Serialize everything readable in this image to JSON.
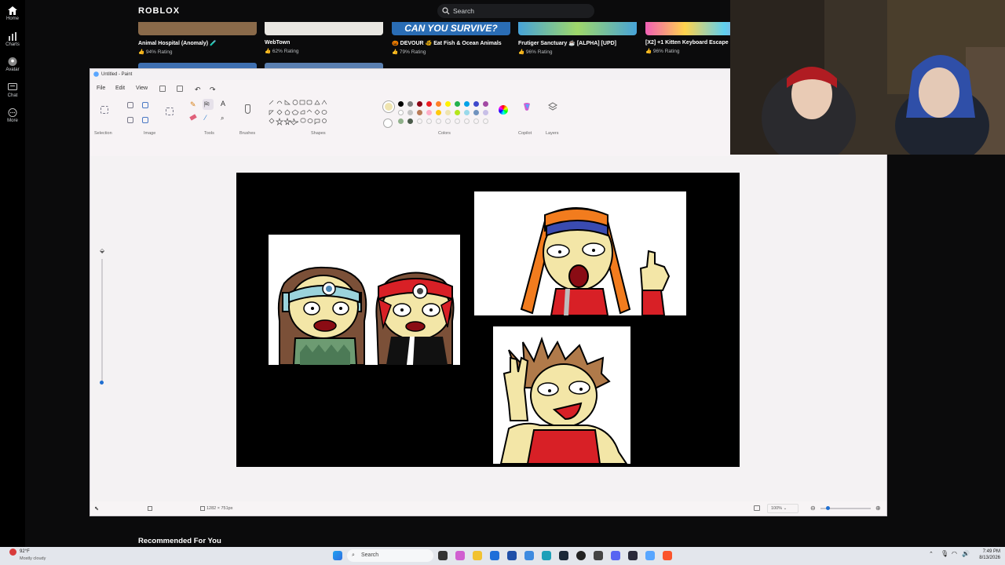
{
  "roblox": {
    "logo": "ROBLOX",
    "search_placeholder": "Search",
    "nav": [
      {
        "label": "Home",
        "icon": "home-icon"
      },
      {
        "label": "Charts",
        "icon": "charts-icon"
      },
      {
        "label": "Avatar",
        "icon": "avatar-icon"
      },
      {
        "label": "Chat",
        "icon": "chat-icon"
      },
      {
        "label": "More",
        "icon": "more-icon"
      }
    ],
    "games": [
      {
        "title": "Animal Hospital (Anomaly) 🧪",
        "rating": "94% Rating",
        "color": "#8a6a4a"
      },
      {
        "title": "WebTown",
        "rating": "62% Rating",
        "color": "#e9e7e2"
      },
      {
        "title": "🎃 DEVOUR 🐠 Eat Fish & Ocean Animals",
        "rating": "79% Rating",
        "color": "#2a6db5",
        "banner": "CAN YOU SURVIVE?"
      },
      {
        "title": "Frutiger Sanctuary ☕ [ALPHA] [UPD]",
        "rating": "96% Rating",
        "color": "#47a3d8"
      },
      {
        "title": "[X2] +1 Kitten Keyboard Escape",
        "rating": "96% Rating",
        "color": "#f05fb5"
      }
    ],
    "recommended": "Recommended For You"
  },
  "paint": {
    "window_title": "Untitled - Paint",
    "menu": [
      "File",
      "Edit",
      "View"
    ],
    "groups": [
      "Selection",
      "Image",
      "Tools",
      "Brushes",
      "Shapes",
      "Colors",
      "Copilot",
      "Layers"
    ],
    "palette_row1": [
      "#000000",
      "#7f7f7f",
      "#880015",
      "#ed1c24",
      "#ff7f27",
      "#fff200",
      "#22b14c",
      "#00a2e8",
      "#3f48cc",
      "#a349a4"
    ],
    "palette_row2": [
      "#ffffff",
      "#c3c3c3",
      "#b97a57",
      "#ffaec9",
      "#ffc90e",
      "#efe4b0",
      "#b5e61d",
      "#99d9ea",
      "#7092be",
      "#c8bfe7"
    ],
    "palette_row3": [
      "#8fb08a",
      "#4a5a4a"
    ],
    "canvas_size": "1282 × 751px",
    "zoom": "100%"
  },
  "taskbar": {
    "weather_temp": "92°F",
    "weather_desc": "Mostly cloudy",
    "search": "Search",
    "time": "7:49 PM",
    "date": "8/13/2026"
  }
}
